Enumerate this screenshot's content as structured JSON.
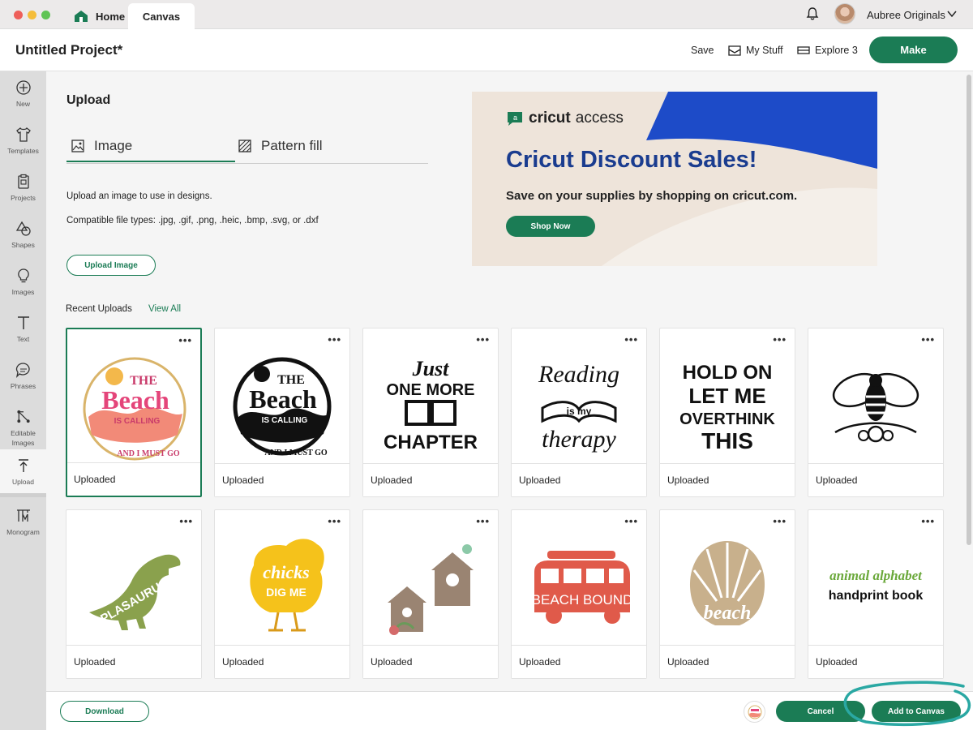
{
  "titlebar": {
    "tabs": [
      {
        "label": "Home"
      },
      {
        "label": "Canvas"
      }
    ],
    "user_name": "Aubree Originals"
  },
  "header": {
    "project_title": "Untitled Project*",
    "save_label": "Save",
    "mystuff_label": "My Stuff",
    "explore_label": "Explore 3",
    "make_label": "Make"
  },
  "rail": {
    "items": [
      {
        "label": "New",
        "icon": "plus-circle-icon"
      },
      {
        "label": "Templates",
        "icon": "shirt-icon"
      },
      {
        "label": "Projects",
        "icon": "clipboard-icon"
      },
      {
        "label": "Shapes",
        "icon": "shapes-icon"
      },
      {
        "label": "Images",
        "icon": "lightbulb-icon"
      },
      {
        "label": "Text",
        "icon": "text-icon"
      },
      {
        "label": "Phrases",
        "icon": "speech-bubble-icon"
      },
      {
        "label": "Editable Images",
        "icon": "editable-image-icon"
      },
      {
        "label": "Upload",
        "icon": "upload-icon",
        "active": true
      },
      {
        "label": "Monogram",
        "icon": "monogram-icon"
      }
    ]
  },
  "upload": {
    "heading": "Upload",
    "tab_image": "Image",
    "tab_pattern": "Pattern fill",
    "desc1": "Upload an image to use in designs.",
    "desc2": "Compatible file types: .jpg, .gif, .png, .heic, .bmp, .svg, or .dxf",
    "upload_button": "Upload Image",
    "recent_label": "Recent Uploads",
    "view_all": "View All"
  },
  "ad": {
    "brand_bold": "cricut",
    "brand_light": "access",
    "title": "Cricut Discount Sales!",
    "subtitle": "Save on your supplies by shopping on cricut.com.",
    "button": "Shop Now"
  },
  "uploads": [
    {
      "label": "Uploaded",
      "more": "•••",
      "art_lines": [
        "THE",
        "Beach",
        "IS CALLING",
        "AND I MUST GO"
      ]
    },
    {
      "label": "Uploaded",
      "more": "•••",
      "art_lines": [
        "THE",
        "Beach",
        "IS CALLING",
        "AND I MUST GO"
      ]
    },
    {
      "label": "Uploaded",
      "more": "•••",
      "art_lines": [
        "Just",
        "ONE MORE",
        "CHAPTER"
      ]
    },
    {
      "label": "Uploaded",
      "more": "•••",
      "art_lines": [
        "Reading",
        "is my",
        "therapy"
      ]
    },
    {
      "label": "Uploaded",
      "more": "•••",
      "art_lines": [
        "HOLD ON",
        "LET ME",
        "OVERTHINK",
        "THIS"
      ]
    },
    {
      "label": "Uploaded",
      "more": "•••",
      "art_lines": []
    },
    {
      "label": "Uploaded",
      "more": "•••",
      "art_lines": [
        "PLASAURUS"
      ]
    },
    {
      "label": "Uploaded",
      "more": "•••",
      "art_lines": [
        "chicks",
        "DIG ME"
      ]
    },
    {
      "label": "Uploaded",
      "more": "•••",
      "art_lines": []
    },
    {
      "label": "Uploaded",
      "more": "•••",
      "art_lines": [
        "BEACH BOUND"
      ]
    },
    {
      "label": "Uploaded",
      "more": "•••",
      "art_lines": [
        "beach"
      ]
    },
    {
      "label": "Uploaded",
      "more": "•••",
      "art_lines": [
        "animal alphabet",
        "handprint book"
      ]
    }
  ],
  "footer": {
    "download": "Download",
    "cancel": "Cancel",
    "add": "Add to Canvas"
  },
  "colors": {
    "accent": "#1b7c55",
    "ad_blue": "#1d4bc8",
    "ad_title": "#1a3c8f",
    "highlight": "#2aa8a3"
  }
}
